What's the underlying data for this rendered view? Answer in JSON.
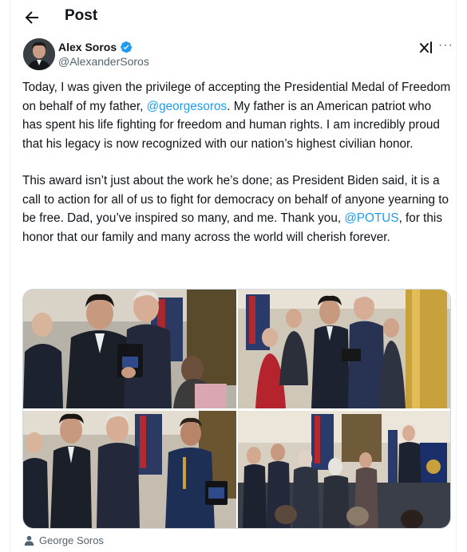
{
  "header": {
    "title": "Post"
  },
  "author": {
    "name": "Alex Soros",
    "handle": "@AlexanderSoros"
  },
  "tweet": {
    "p1_before": "Today, I was given the privilege of accepting the Presidential Medal of Freedom on behalf of my father, ",
    "p1_mention": "@georgesoros",
    "p1_after": ". My father is an American patriot who has spent his life fighting for freedom and human rights. I am incredibly proud that his legacy is now recognized with our nation’s highest civilian honor.",
    "p2_before": "This award isn’t just about the work he’s done; as President Biden said, it is a call to action for all of us to fight for democracy on behalf of anyone yearning to be free. Dad, you’ve inspired so many, and me. Thank you, ",
    "p2_mention": "@POTUS",
    "p2_after": ", for this honor that our family and many across the world will cherish forever."
  },
  "media_caption": "George Soros",
  "icons": {
    "back": "arrow-left-icon",
    "verified": "verified-badge-icon",
    "grok": "grok-icon",
    "more": "more-icon",
    "person": "person-icon"
  },
  "colors": {
    "accent": "#1d9bf0",
    "secondary_text": "#536471",
    "text": "#0f1419"
  }
}
